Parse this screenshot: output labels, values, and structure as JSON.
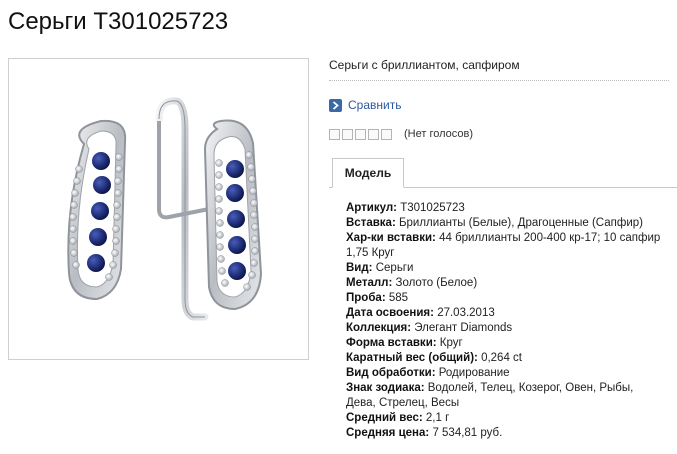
{
  "page": {
    "title": "Серьги T301025723",
    "subtitle": "Серьги с бриллиантом, сапфиром"
  },
  "compare": {
    "label": "Сравнить",
    "icon": "chevron-right-icon"
  },
  "rating": {
    "stars_total": 5,
    "stars_filled": 0,
    "votes_text": "(Нет голосов)"
  },
  "tabs": [
    {
      "label": "Модель",
      "active": true
    }
  ],
  "specs": [
    {
      "label": "Артикул:",
      "value": "T301025723"
    },
    {
      "label": "Вставка:",
      "value": "Бриллианты (Белые), Драгоценные (Сапфир)"
    },
    {
      "label": "Хар-ки вставки:",
      "value": "44 бриллианты 200-400 кр-17; 10 сапфир 1,75 Круг"
    },
    {
      "label": "Вид:",
      "value": "Серьги"
    },
    {
      "label": "Металл:",
      "value": "Золото (Белое)"
    },
    {
      "label": "Проба:",
      "value": "585"
    },
    {
      "label": "Дата освоения:",
      "value": "27.03.2013"
    },
    {
      "label": "Коллекция:",
      "value": "Элегант Diamonds"
    },
    {
      "label": "Форма вставки:",
      "value": "Круг"
    },
    {
      "label": "Каратный вес (общий):",
      "value": "0,264 ct"
    },
    {
      "label": "Вид обработки:",
      "value": "Родирование"
    },
    {
      "label": "Знак зодиака:",
      "value": "Водолей, Телец, Козерог, Овен, Рыбы, Дева, Стрелец, Весы"
    },
    {
      "label": "Средний вес:",
      "value": "2,1 г"
    },
    {
      "label": "Средняя цена:",
      "value": "7 534,81 руб."
    }
  ],
  "colors": {
    "link": "#2c5aa0",
    "sapphire": "#1f2f7a",
    "metal": "#c9ccd1"
  }
}
